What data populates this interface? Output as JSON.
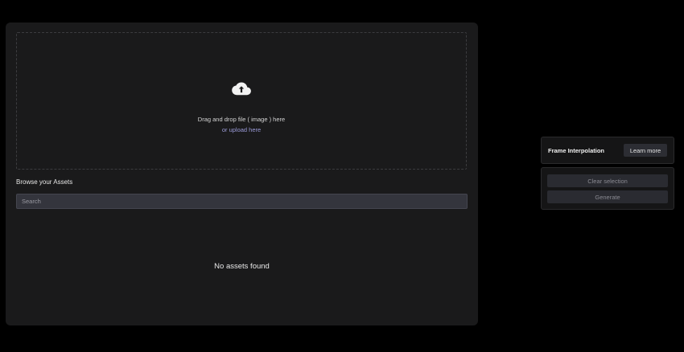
{
  "upload": {
    "drop_text": "Drag and drop file ( image ) here",
    "upload_link": "or upload here",
    "icon": "cloud-upload-icon"
  },
  "assets": {
    "title": "Browse your Assets",
    "search_placeholder": "Search",
    "empty_message": "No assets found"
  },
  "side_panel": {
    "title": "Frame Interpolation",
    "learn_more_label": "Learn more",
    "clear_selection_label": "Clear selection",
    "generate_label": "Generate"
  },
  "colors": {
    "background": "#000000",
    "panel": "#1a1a1b",
    "link": "#9b9bd8",
    "input": "#34353d"
  }
}
